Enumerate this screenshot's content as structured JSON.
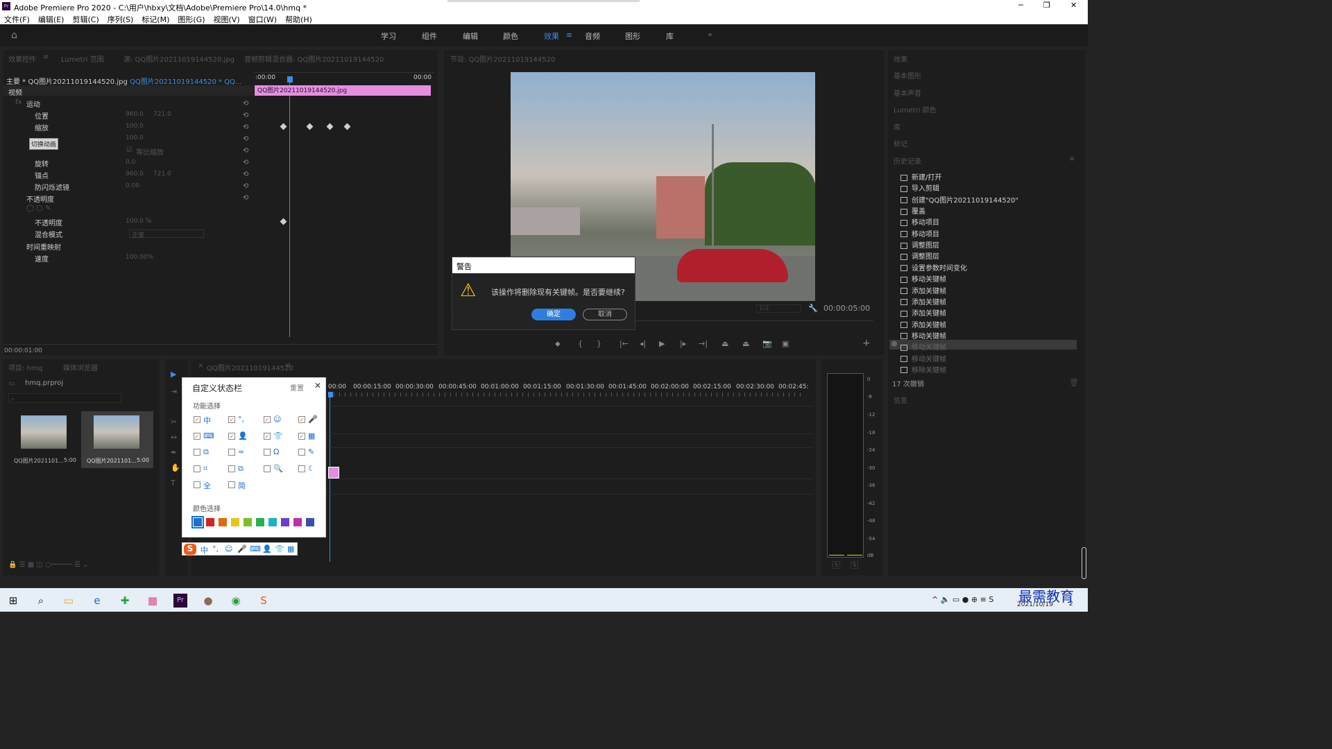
{
  "window": {
    "title": "Adobe Premiere Pro 2020 - C:\\用户\\hbxy\\文档\\Adobe\\Premiere Pro\\14.0\\hmq *",
    "min": "─",
    "max": "❐",
    "close": "✕"
  },
  "menu": [
    "文件(F)",
    "编辑(E)",
    "剪辑(C)",
    "序列(S)",
    "标记(M)",
    "图形(G)",
    "视图(V)",
    "窗口(W)",
    "帮助(H)"
  ],
  "workspaces": [
    "学习",
    "组件",
    "编辑",
    "颜色",
    "效果",
    "音频",
    "图形",
    "库"
  ],
  "active_workspace": "效果",
  "top_tabs": {
    "effect_controls": "效果控件",
    "lumetri_scope": "Lumetri 范围",
    "source": "源: QQ图片20211019144520.jpg",
    "audio_mixer": "音频剪辑混合器: QQ图片20211019144520",
    "program": "节目: QQ图片20211019144520"
  },
  "ec": {
    "master": "主要 * QQ图片20211019144520.jpg",
    "clip": "QQ图片20211019144520 * QQ...",
    "t_start": ":00:00",
    "t_end": "00:00",
    "clip_bar": "QQ图片20211019144520.jpg",
    "video": "视频",
    "motion": "运动",
    "position": "位置",
    "pos_x": "960.0",
    "pos_y": "721.0",
    "scale": "缩放",
    "scale_v": "100.0",
    "scale_w": "100.0",
    "tooltip": "切换动画",
    "uniform": "等比缩放",
    "rotation": "旋转",
    "rot_v": "0.0",
    "anchor": "锚点",
    "anc_x": "960.0",
    "anc_y": "721.0",
    "flicker": "防闪烁滤镜",
    "flicker_v": "0.00",
    "opacity_group": "不透明度",
    "opacity": "不透明度",
    "opacity_v": "100.0 %",
    "blend": "混合模式",
    "blend_v": "正常",
    "time_remap": "时间重映射",
    "speed": "速度",
    "speed_v": "100.00%",
    "timecode": "00:00:01:00"
  },
  "program": {
    "zoom": "1/2",
    "timecode": "00:00:05:00"
  },
  "right_panels": [
    "效果",
    "基本图形",
    "基本声音",
    "Lumetri 颜色",
    "库",
    "标记",
    "历史记录"
  ],
  "history": [
    "新建/打开",
    "导入剪辑",
    "创建\"QQ图片20211019144520\"",
    "覆盖",
    "移动项目",
    "移动项目",
    "调整图层",
    "调整图层",
    "设置参数时间变化",
    "移动关键帧",
    "添加关键帧",
    "添加关键帧",
    "添加关键帧",
    "添加关键帧",
    "移动关键帧",
    "移动关键帧",
    "移动关键帧",
    "移除关键帧"
  ],
  "history_footer": "17 次撤销",
  "info_panel": "信息",
  "project": {
    "tab": "项目: hmq",
    "browser": "媒体浏览器",
    "file": "hmq.prproj",
    "items": [
      {
        "name": "QQ图片2021101...",
        "dur": "5:00"
      },
      {
        "name": "QQ图片2021101...",
        "dur": "5:00"
      }
    ]
  },
  "timeline": {
    "tab": "QQ图片20211019144520",
    "ruler": [
      "00:00",
      "00:00:15:00",
      "00:00:30:00",
      "00:00:45:00",
      "00:01:00:00",
      "00:01:15:00",
      "00:01:30:00",
      "00:01:45:00",
      "00:02:00:00",
      "00:02:15:00",
      "00:02:30:00",
      "00:02:45:"
    ]
  },
  "meter": {
    "ticks": [
      "0",
      "-6",
      "-12",
      "-18",
      "-24",
      "-30",
      "-36",
      "-42",
      "-48",
      "-54",
      "dB"
    ],
    "s1": "S",
    "s2": "S"
  },
  "ime": {
    "title": "自定义状态栏",
    "reset": "重置",
    "close": "✕",
    "section1": "功能选择",
    "section2": "颜色选择",
    "items": [
      {
        "g": "中",
        "c": true
      },
      {
        "g": "°,",
        "c": true
      },
      {
        "g": "☺",
        "c": true
      },
      {
        "g": "🎤",
        "c": true
      },
      {
        "g": "⌨",
        "c": true
      },
      {
        "g": "👤",
        "c": true
      },
      {
        "g": "👕",
        "c": true
      },
      {
        "g": "▦",
        "c": true
      },
      {
        "g": "⧉",
        "c": false
      },
      {
        "g": "≈",
        "c": false
      },
      {
        "g": "Ω",
        "c": false
      },
      {
        "g": "✎",
        "c": false
      },
      {
        "g": "⌗",
        "c": false
      },
      {
        "g": "⧉",
        "c": false
      },
      {
        "g": "🔍",
        "c": false
      },
      {
        "g": "☾",
        "c": false
      },
      {
        "g": "全",
        "c": false
      },
      {
        "g": "简",
        "c": false
      }
    ],
    "colors": [
      "#1e6fd1",
      "#d42424",
      "#e06a10",
      "#e6c61a",
      "#7abf2a",
      "#27b150",
      "#1cb2c2",
      "#6f3cd0",
      "#c02ea8",
      "#3b4fb0"
    ],
    "bar": [
      "S",
      "中",
      "°,",
      "☺",
      "🎤",
      "⌨",
      "👤",
      "👕",
      "▦"
    ]
  },
  "dialog": {
    "title": "警告",
    "message": "该操作将删除现有关键帧。是否要继续?",
    "ok": "确定",
    "cancel": "取消"
  },
  "taskbar": {
    "time": "2021/10/19",
    "watermark": "最需教育",
    "badge": "2"
  }
}
